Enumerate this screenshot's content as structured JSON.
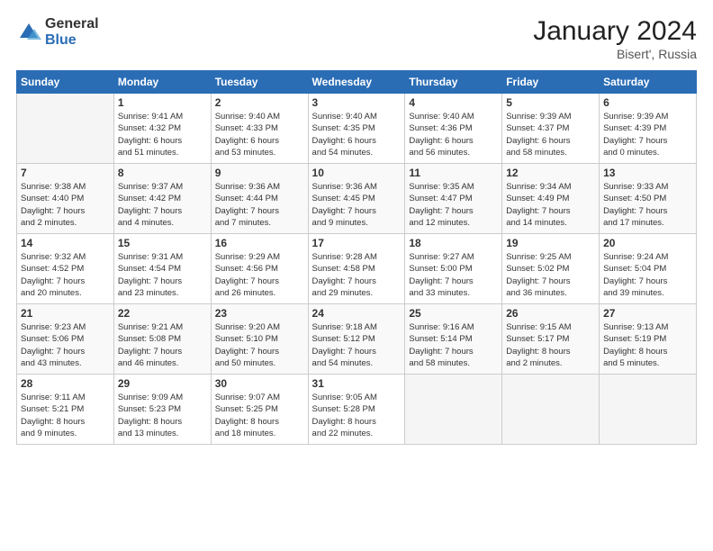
{
  "logo": {
    "general": "General",
    "blue": "Blue"
  },
  "header": {
    "title": "January 2024",
    "subtitle": "Bisert', Russia"
  },
  "weekdays": [
    "Sunday",
    "Monday",
    "Tuesday",
    "Wednesday",
    "Thursday",
    "Friday",
    "Saturday"
  ],
  "weeks": [
    [
      {
        "day": "",
        "info": ""
      },
      {
        "day": "1",
        "info": "Sunrise: 9:41 AM\nSunset: 4:32 PM\nDaylight: 6 hours\nand 51 minutes."
      },
      {
        "day": "2",
        "info": "Sunrise: 9:40 AM\nSunset: 4:33 PM\nDaylight: 6 hours\nand 53 minutes."
      },
      {
        "day": "3",
        "info": "Sunrise: 9:40 AM\nSunset: 4:35 PM\nDaylight: 6 hours\nand 54 minutes."
      },
      {
        "day": "4",
        "info": "Sunrise: 9:40 AM\nSunset: 4:36 PM\nDaylight: 6 hours\nand 56 minutes."
      },
      {
        "day": "5",
        "info": "Sunrise: 9:39 AM\nSunset: 4:37 PM\nDaylight: 6 hours\nand 58 minutes."
      },
      {
        "day": "6",
        "info": "Sunrise: 9:39 AM\nSunset: 4:39 PM\nDaylight: 7 hours\nand 0 minutes."
      }
    ],
    [
      {
        "day": "7",
        "info": "Sunrise: 9:38 AM\nSunset: 4:40 PM\nDaylight: 7 hours\nand 2 minutes."
      },
      {
        "day": "8",
        "info": "Sunrise: 9:37 AM\nSunset: 4:42 PM\nDaylight: 7 hours\nand 4 minutes."
      },
      {
        "day": "9",
        "info": "Sunrise: 9:36 AM\nSunset: 4:44 PM\nDaylight: 7 hours\nand 7 minutes."
      },
      {
        "day": "10",
        "info": "Sunrise: 9:36 AM\nSunset: 4:45 PM\nDaylight: 7 hours\nand 9 minutes."
      },
      {
        "day": "11",
        "info": "Sunrise: 9:35 AM\nSunset: 4:47 PM\nDaylight: 7 hours\nand 12 minutes."
      },
      {
        "day": "12",
        "info": "Sunrise: 9:34 AM\nSunset: 4:49 PM\nDaylight: 7 hours\nand 14 minutes."
      },
      {
        "day": "13",
        "info": "Sunrise: 9:33 AM\nSunset: 4:50 PM\nDaylight: 7 hours\nand 17 minutes."
      }
    ],
    [
      {
        "day": "14",
        "info": "Sunrise: 9:32 AM\nSunset: 4:52 PM\nDaylight: 7 hours\nand 20 minutes."
      },
      {
        "day": "15",
        "info": "Sunrise: 9:31 AM\nSunset: 4:54 PM\nDaylight: 7 hours\nand 23 minutes."
      },
      {
        "day": "16",
        "info": "Sunrise: 9:29 AM\nSunset: 4:56 PM\nDaylight: 7 hours\nand 26 minutes."
      },
      {
        "day": "17",
        "info": "Sunrise: 9:28 AM\nSunset: 4:58 PM\nDaylight: 7 hours\nand 29 minutes."
      },
      {
        "day": "18",
        "info": "Sunrise: 9:27 AM\nSunset: 5:00 PM\nDaylight: 7 hours\nand 33 minutes."
      },
      {
        "day": "19",
        "info": "Sunrise: 9:25 AM\nSunset: 5:02 PM\nDaylight: 7 hours\nand 36 minutes."
      },
      {
        "day": "20",
        "info": "Sunrise: 9:24 AM\nSunset: 5:04 PM\nDaylight: 7 hours\nand 39 minutes."
      }
    ],
    [
      {
        "day": "21",
        "info": "Sunrise: 9:23 AM\nSunset: 5:06 PM\nDaylight: 7 hours\nand 43 minutes."
      },
      {
        "day": "22",
        "info": "Sunrise: 9:21 AM\nSunset: 5:08 PM\nDaylight: 7 hours\nand 46 minutes."
      },
      {
        "day": "23",
        "info": "Sunrise: 9:20 AM\nSunset: 5:10 PM\nDaylight: 7 hours\nand 50 minutes."
      },
      {
        "day": "24",
        "info": "Sunrise: 9:18 AM\nSunset: 5:12 PM\nDaylight: 7 hours\nand 54 minutes."
      },
      {
        "day": "25",
        "info": "Sunrise: 9:16 AM\nSunset: 5:14 PM\nDaylight: 7 hours\nand 58 minutes."
      },
      {
        "day": "26",
        "info": "Sunrise: 9:15 AM\nSunset: 5:17 PM\nDaylight: 8 hours\nand 2 minutes."
      },
      {
        "day": "27",
        "info": "Sunrise: 9:13 AM\nSunset: 5:19 PM\nDaylight: 8 hours\nand 5 minutes."
      }
    ],
    [
      {
        "day": "28",
        "info": "Sunrise: 9:11 AM\nSunset: 5:21 PM\nDaylight: 8 hours\nand 9 minutes."
      },
      {
        "day": "29",
        "info": "Sunrise: 9:09 AM\nSunset: 5:23 PM\nDaylight: 8 hours\nand 13 minutes."
      },
      {
        "day": "30",
        "info": "Sunrise: 9:07 AM\nSunset: 5:25 PM\nDaylight: 8 hours\nand 18 minutes."
      },
      {
        "day": "31",
        "info": "Sunrise: 9:05 AM\nSunset: 5:28 PM\nDaylight: 8 hours\nand 22 minutes."
      },
      {
        "day": "",
        "info": ""
      },
      {
        "day": "",
        "info": ""
      },
      {
        "day": "",
        "info": ""
      }
    ]
  ]
}
